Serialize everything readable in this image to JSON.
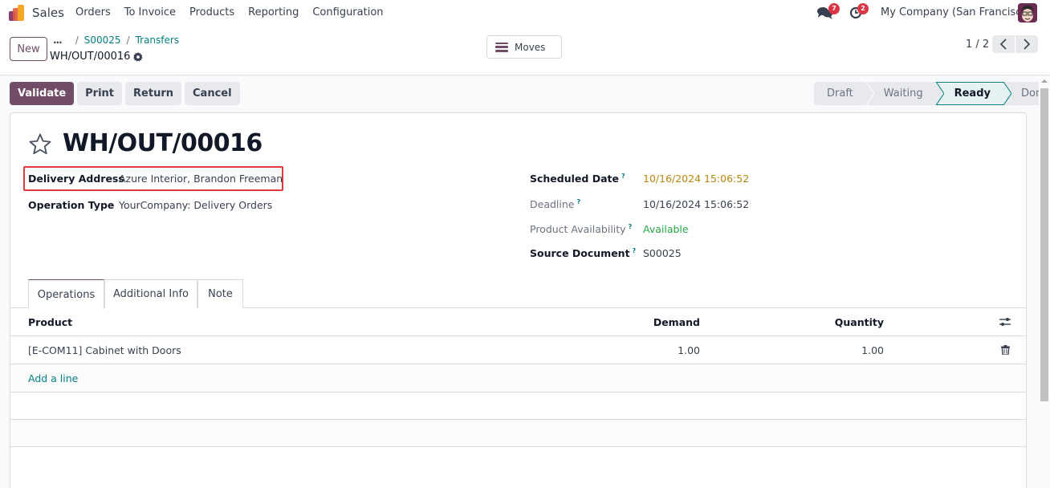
{
  "navbar": {
    "app_name": "Sales",
    "menu": [
      "Orders",
      "To Invoice",
      "Products",
      "Reporting",
      "Configuration"
    ],
    "messages_badge": "7",
    "activities_badge": "2",
    "company": "My Company (San Francisco)"
  },
  "control": {
    "new_label": "New",
    "breadcrumb": {
      "ellipsis": "...",
      "items": [
        "S00025",
        "Transfers"
      ]
    },
    "record_name": "WH/OUT/00016",
    "moves_label": "Moves",
    "pager": "1 / 2"
  },
  "actions": {
    "validate": "Validate",
    "print": "Print",
    "return": "Return",
    "cancel": "Cancel"
  },
  "statusbar": {
    "stages": [
      "Draft",
      "Waiting",
      "Ready",
      "Done"
    ],
    "current": "Ready"
  },
  "form": {
    "title": "WH/OUT/00016",
    "left": {
      "delivery_address_label": "Delivery Address",
      "delivery_address_value": "Azure Interior, Brandon Freeman",
      "operation_type_label": "Operation Type",
      "operation_type_value": "YourCompany: Delivery Orders"
    },
    "right": {
      "scheduled_date_label": "Scheduled Date",
      "scheduled_date_value": "10/16/2024 15:06:52",
      "deadline_label": "Deadline",
      "deadline_value": "10/16/2024 15:06:52",
      "availability_label": "Product Availability",
      "availability_value": "Available",
      "source_label": "Source Document",
      "source_value": "S00025",
      "help_mark": "?"
    },
    "colors": {
      "scheduled_date": "#b8860b",
      "available": "#28a745",
      "highlight": "#e0393e"
    }
  },
  "tabs": [
    "Operations",
    "Additional Info",
    "Note"
  ],
  "table": {
    "headers": {
      "product": "Product",
      "demand": "Demand",
      "quantity": "Quantity"
    },
    "rows": [
      {
        "product": "[E-COM11] Cabinet with Doors",
        "demand": "1.00",
        "quantity": "1.00"
      }
    ],
    "add_line": "Add a line"
  }
}
